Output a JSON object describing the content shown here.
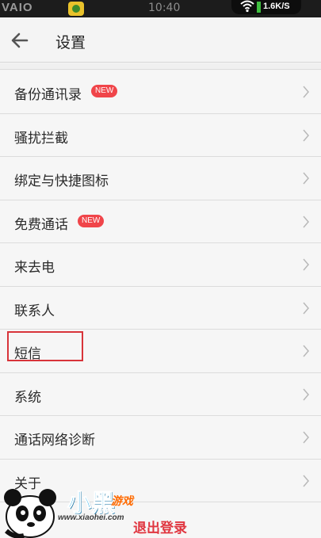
{
  "status_bar": {
    "brand": "VAIO",
    "time": "10:40",
    "network_speed": "1.6K/S"
  },
  "header": {
    "title": "设置"
  },
  "settings_items": [
    {
      "label": "备份通讯录",
      "badge": "NEW"
    },
    {
      "label": "骚扰拦截"
    },
    {
      "label": "绑定与快捷图标"
    },
    {
      "label": "免费通话",
      "badge": "NEW"
    },
    {
      "label": "来去电"
    },
    {
      "label": "联系人"
    },
    {
      "label": "短信",
      "highlighted": true
    },
    {
      "label": "系统"
    },
    {
      "label": "通话网络诊断"
    },
    {
      "label": "关于"
    }
  ],
  "logout": {
    "label": "退出登录"
  },
  "watermark": {
    "title": "小黑",
    "subtitle": "游戏",
    "url": "www.xiaohei.com"
  },
  "colors": {
    "badge": "#f0454a",
    "logout": "#e03640",
    "highlight_border": "#d8343a"
  }
}
